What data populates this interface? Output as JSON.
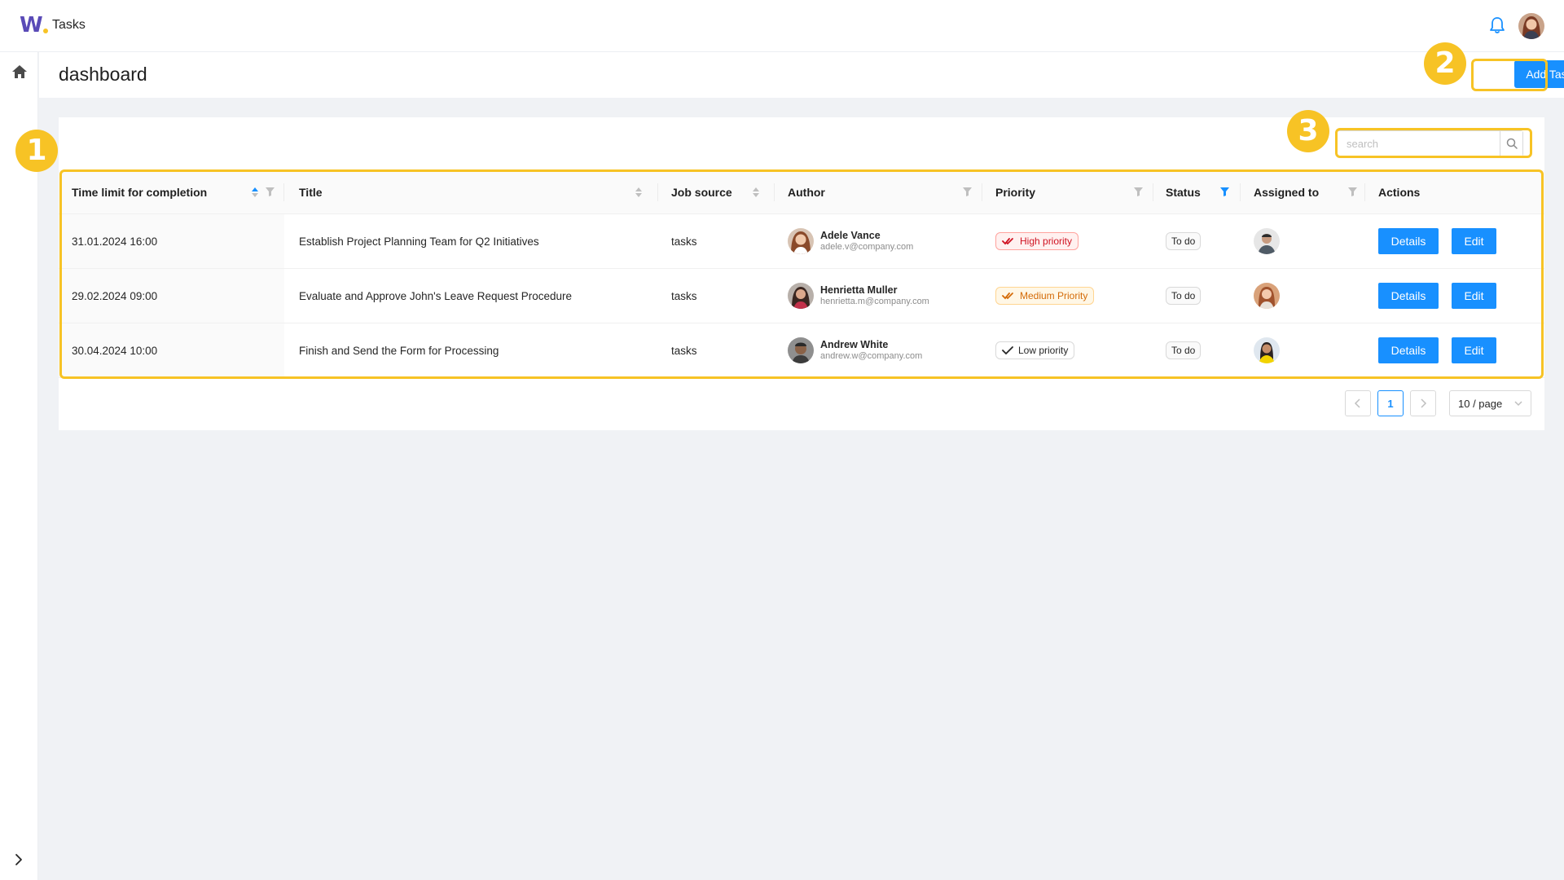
{
  "app": {
    "title": "Tasks"
  },
  "page": {
    "title": "dashboard",
    "add_task_label": "Add Task"
  },
  "search": {
    "placeholder": "search",
    "value": ""
  },
  "table": {
    "columns": [
      "Time limit for completion",
      "Title",
      "Job source",
      "Author",
      "Priority",
      "Status",
      "Assigned to",
      "Actions"
    ],
    "rows": [
      {
        "time_limit": "31.01.2024 16:00",
        "title": "Establish Project Planning Team for Q2 Initiatives",
        "job_source": "tasks",
        "author_name": "Adele Vance",
        "author_email": "adele.v@company.com",
        "priority": "High priority",
        "status": "To do",
        "details_label": "Details",
        "edit_label": "Edit"
      },
      {
        "time_limit": "29.02.2024 09:00",
        "title": "Evaluate and Approve John's Leave Request Procedure",
        "job_source": "tasks",
        "author_name": "Henrietta Muller",
        "author_email": "henrietta.m@company.com",
        "priority": "Medium Priority",
        "status": "To do",
        "details_label": "Details",
        "edit_label": "Edit"
      },
      {
        "time_limit": "30.04.2024 10:00",
        "title": "Finish and Send the Form for Processing",
        "job_source": "tasks",
        "author_name": "Andrew White",
        "author_email": "andrew.w@company.com",
        "priority": "Low priority",
        "status": "To do",
        "details_label": "Details",
        "edit_label": "Edit"
      }
    ]
  },
  "pagination": {
    "current_page": "1",
    "page_size": "10 / page"
  },
  "annotations": {
    "marker_1": "1",
    "marker_2": "2",
    "marker_3": "3"
  },
  "colors": {
    "primary": "#1890ff",
    "highlight": "#f7c325",
    "high_priority": "#cf1322",
    "medium_priority": "#d46b08",
    "brand": "#5a4bb7"
  },
  "icons": [
    "logo",
    "bell-icon",
    "user-avatar",
    "home-icon",
    "expand-icon",
    "search-icon",
    "sort-icon",
    "filter-icon",
    "double-check-icon",
    "check-icon",
    "chevron-left-icon",
    "chevron-right-icon",
    "chevron-down-icon"
  ]
}
